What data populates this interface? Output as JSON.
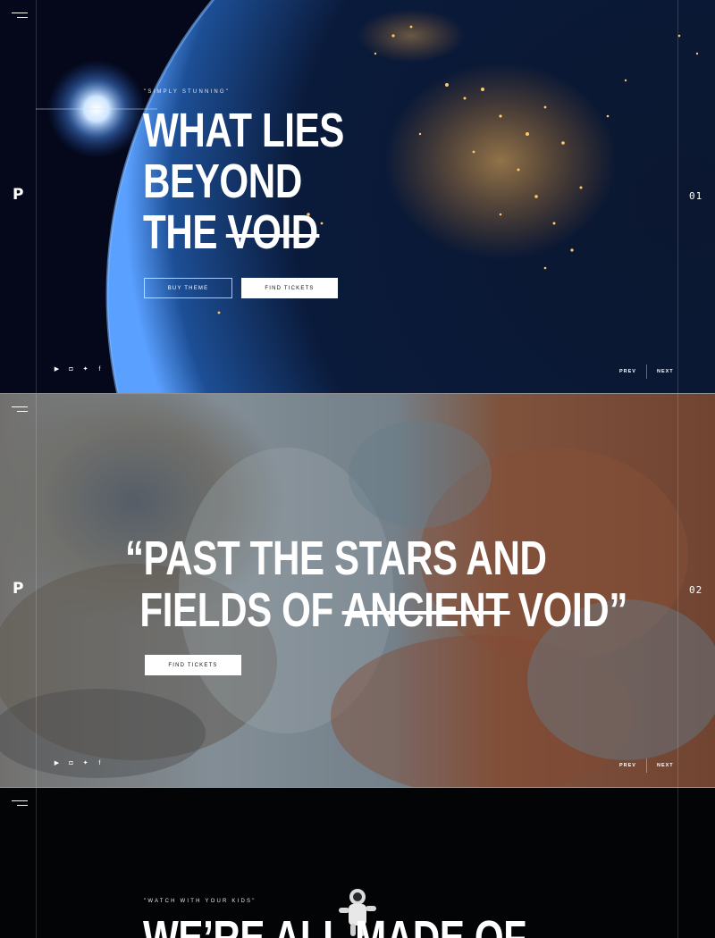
{
  "colors": {
    "accent": "#ffffff",
    "button_text": "#111111",
    "space_bg": "#050a18",
    "mars_rust": "#8a4a32",
    "mars_blue": "#6e8796"
  },
  "brand": {
    "logo": "P"
  },
  "nav": {
    "menu_icon": "hamburger-menu-icon"
  },
  "slides": [
    {
      "number": "01",
      "eyebrow": "\"SIMPLY STUNNING\"",
      "headline": {
        "line1": "WHAT LIES",
        "line2": "BEYOND",
        "line3_plain": "THE ",
        "line3_strike": "VOID"
      },
      "buttons": {
        "secondary": "BUY THEME",
        "primary": "FIND TICKETS"
      },
      "social_icons": [
        "youtube-icon",
        "instagram-icon",
        "twitter-icon",
        "facebook-icon"
      ],
      "pager": {
        "prev": "PREV",
        "next": "NEXT"
      }
    },
    {
      "number": "02",
      "quote": {
        "line1": "“PAST THE STARS AND",
        "line2_plain": "FIELDS OF ",
        "line2_strike": "ANCIENT",
        "line2_end": " VOID”"
      },
      "buttons": {
        "primary": "FIND TICKETS"
      },
      "social_icons": [
        "youtube-icon",
        "instagram-icon",
        "twitter-icon",
        "facebook-icon"
      ],
      "pager": {
        "prev": "PREV",
        "next": "NEXT"
      }
    },
    {
      "eyebrow": "\"WATCH WITH YOUR KIDS\"",
      "headline": "WE’RE ALL MADE OF"
    }
  ]
}
